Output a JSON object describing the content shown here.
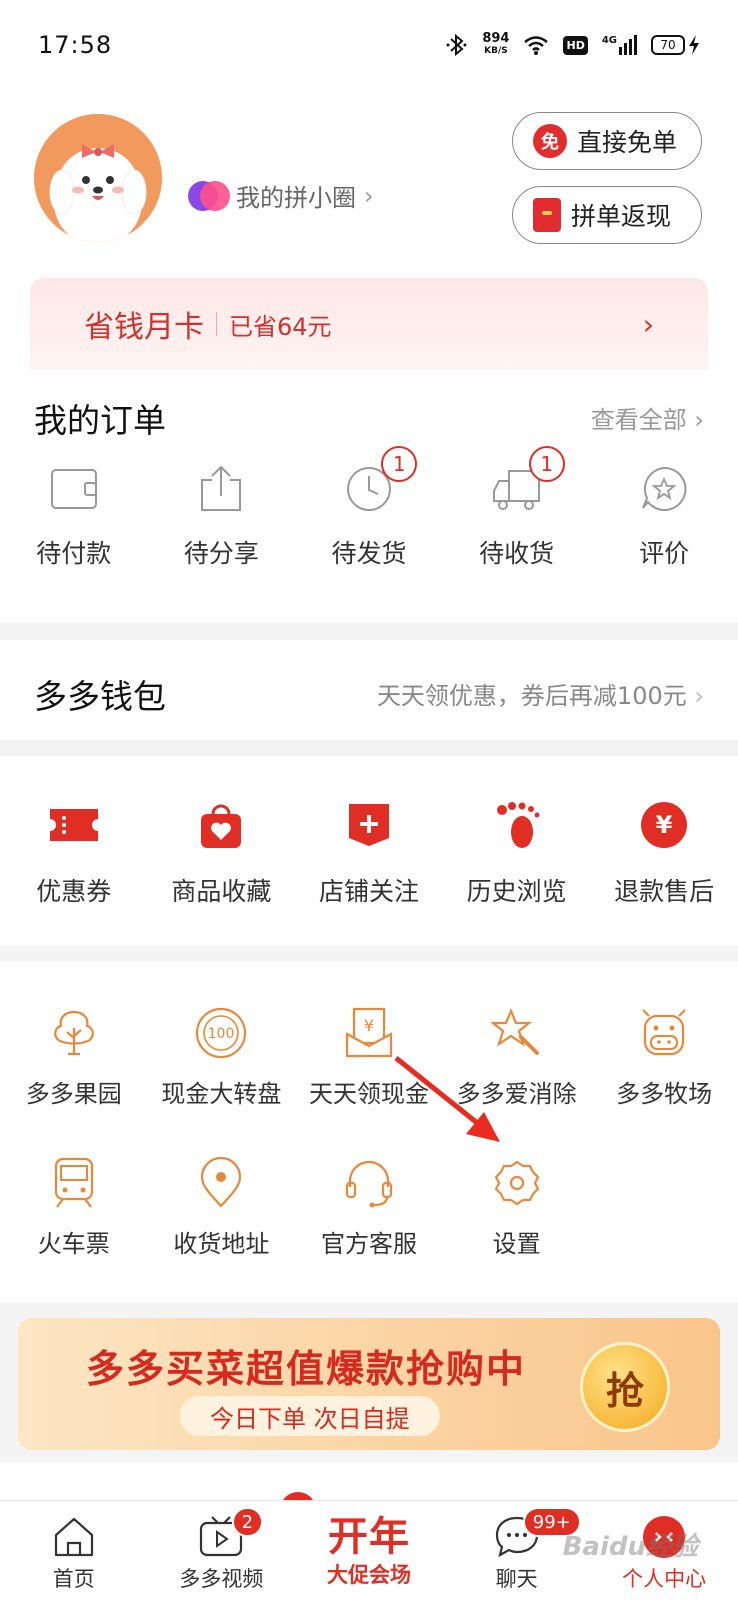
{
  "status_bar": {
    "time": "17:58",
    "net_speed": "894",
    "net_unit": "KB/S",
    "hd": "HD",
    "signal": "4G",
    "battery": "70"
  },
  "profile": {
    "circle_link": "我的拼小圈",
    "free_order_badge": "免",
    "free_order_label": "直接免单",
    "cashback_label": "拼单返现"
  },
  "savings_card": {
    "title": "省钱月卡",
    "saved": "已省64元"
  },
  "orders": {
    "title": "我的订单",
    "view_all": "查看全部",
    "items": [
      {
        "label": "待付款",
        "icon": "wallet-icon",
        "badge": null
      },
      {
        "label": "待分享",
        "icon": "share-icon",
        "badge": null
      },
      {
        "label": "待发货",
        "icon": "clock-icon",
        "badge": "1"
      },
      {
        "label": "待收货",
        "icon": "truck-icon",
        "badge": "1"
      },
      {
        "label": "评价",
        "icon": "star-bubble-icon",
        "badge": null
      }
    ]
  },
  "wallet": {
    "title": "多多钱包",
    "promo": "天天领优惠，券后再减100元"
  },
  "services": [
    {
      "label": "优惠券",
      "icon": "coupon-icon"
    },
    {
      "label": "商品收藏",
      "icon": "bag-heart-icon"
    },
    {
      "label": "店铺关注",
      "icon": "store-plus-icon"
    },
    {
      "label": "历史浏览",
      "icon": "footprint-icon"
    },
    {
      "label": "退款售后",
      "icon": "yen-circle-icon"
    }
  ],
  "tools": {
    "row1": [
      {
        "label": "多多果园",
        "icon": "tree-icon"
      },
      {
        "label": "现金大转盘",
        "icon": "wheel-100-icon"
      },
      {
        "label": "天天领现金",
        "icon": "cash-envelope-icon"
      },
      {
        "label": "多多爱消除",
        "icon": "star-wand-icon"
      },
      {
        "label": "多多牧场",
        "icon": "cow-icon"
      }
    ],
    "row2": [
      {
        "label": "火车票",
        "icon": "train-icon"
      },
      {
        "label": "收货地址",
        "icon": "location-icon"
      },
      {
        "label": "官方客服",
        "icon": "headset-icon"
      },
      {
        "label": "设置",
        "icon": "settings-icon"
      }
    ],
    "wheel_text": "100",
    "envelope_text": "¥"
  },
  "banner": {
    "title": "多多买菜超值爆款抢购中",
    "subtitle": "今日下单 次日自提",
    "button": "抢"
  },
  "tabbar": [
    {
      "label": "首页",
      "icon": "home-icon",
      "badge": null
    },
    {
      "label": "多多视频",
      "icon": "video-icon",
      "badge": "2"
    },
    {
      "label": "大促会场",
      "big_text": "开年",
      "badge": null
    },
    {
      "label": "聊天",
      "icon": "chat-icon",
      "badge": "99+"
    },
    {
      "label": "个人中心",
      "icon": "profile-icon",
      "badge": null
    }
  ],
  "watermark": "Baidu经验",
  "colors": {
    "brand_red": "#e02e24",
    "tool_orange": "#e8883a",
    "savings_bg": "#fde8e6"
  }
}
